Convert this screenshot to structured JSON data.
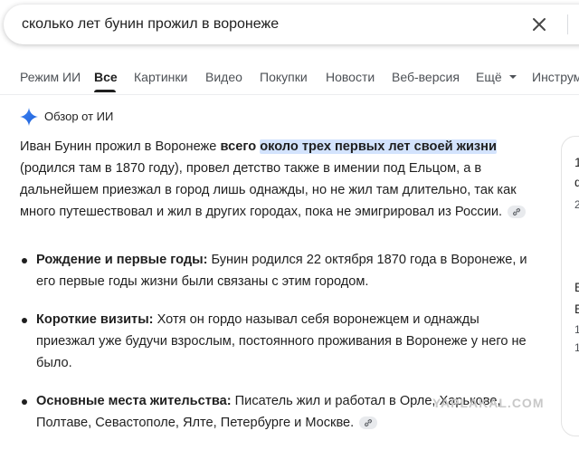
{
  "search": {
    "query": "сколько лет бунин прожил в воронеже"
  },
  "tabs": [
    {
      "label": "Режим ИИ"
    },
    {
      "label": "Все"
    },
    {
      "label": "Картинки"
    },
    {
      "label": "Видео"
    },
    {
      "label": "Покупки"
    },
    {
      "label": "Новости"
    },
    {
      "label": "Веб-версия"
    },
    {
      "label": "Ещё"
    },
    {
      "label": "Инструм"
    }
  ],
  "ai_overview": {
    "title": "Обзор от ИИ",
    "intro_before": "Иван Бунин прожил в Воронеже ",
    "intro_bold": "всего",
    "intro_space": " ",
    "intro_highlight": "около трех первых лет своей жизни",
    "intro_after": " (родился там в 1870 году), провел детство также в имении под Ельцом, а в дальнейшем приезжал в город лишь однажды, но не жил там длительно, так как много путешествовал и жил в других городах, пока не эмигрировал из России.",
    "bullets": [
      {
        "term": "Рождение и первые годы:",
        "text": " Бунин родился 22 октября 1870 года в Воронеже, и его первые годы жизни были связаны с этим городом."
      },
      {
        "term": "Короткие визиты:",
        "text": " Хотя он гордо называл себя воронежцем и однажды приезжал уже будучи взрослым, постоянного проживания в Воронеже у него не было."
      },
      {
        "term": "Основные места жительства:",
        "text": " Писатель жил и работал в Орле, Харькове, Полтаве, Севастополе, Ялте, Петербурге и Москве."
      }
    ]
  },
  "side_panel": {
    "t1": "1",
    "t2": "ф",
    "t3": "2",
    "t4": "Е",
    "t5": "Е",
    "t6": "1",
    "t7": "1"
  },
  "watermark": "YAPLAKAL.COM",
  "colors": {
    "highlight": "#d3e3fd",
    "accent_blue": "#4285f4"
  }
}
